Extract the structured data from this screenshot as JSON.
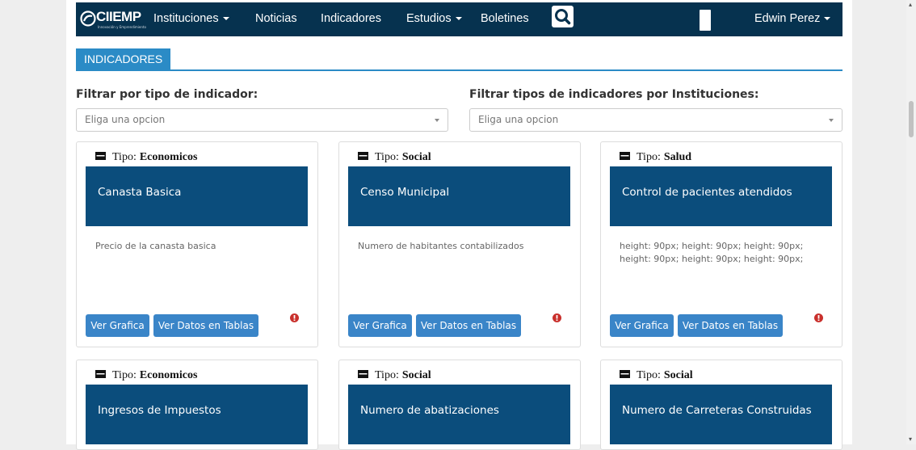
{
  "navbar": {
    "brand": "CIIEMP",
    "brand_sub": "Innovación y Emprendimiento",
    "items": [
      {
        "label": "Instituciones",
        "caret": true
      },
      {
        "label": "Noticias",
        "caret": false
      },
      {
        "label": "Indicadores",
        "caret": false
      },
      {
        "label": "Estudios",
        "caret": true
      },
      {
        "label": "Boletines",
        "caret": false
      }
    ],
    "user": "Edwin Perez",
    "icons": [
      "search-icon",
      "caret-down-icon"
    ]
  },
  "section": {
    "title": "INDICADORES"
  },
  "filters": {
    "type_label": "Filtrar por tipo de indicador:",
    "type_placeholder": "Eliga una opcion",
    "inst_label": "Filtrar tipos de indicadores por Instituciones:",
    "inst_placeholder": "Eliga una opcion"
  },
  "cards": [
    {
      "tipo_label": "Tipo:",
      "tipo": "Economicos",
      "title": "Canasta Basica",
      "desc": "Precio de la canasta basica",
      "btn_grafica": "Ver Grafica",
      "btn_tablas": "Ver Datos en Tablas"
    },
    {
      "tipo_label": "Tipo:",
      "tipo": "Social",
      "title": "Censo Municipal",
      "desc": "Numero de habitantes contabilizados",
      "btn_grafica": "Ver Grafica",
      "btn_tablas": "Ver Datos en Tablas"
    },
    {
      "tipo_label": "Tipo:",
      "tipo": "Salud",
      "title": "Control de pacientes atendidos",
      "desc": "height: 90px; height: 90px; height: 90px; height: 90px; height: 90px; height: 90px;",
      "btn_grafica": "Ver Grafica",
      "btn_tablas": "Ver Datos en Tablas"
    },
    {
      "tipo_label": "Tipo:",
      "tipo": "Economicos",
      "title": "Ingresos de Impuestos"
    },
    {
      "tipo_label": "Tipo:",
      "tipo": "Social",
      "title": "Numero de abatizaciones"
    },
    {
      "tipo_label": "Tipo:",
      "tipo": "Social",
      "title": "Numero de Carreteras Construidas"
    }
  ],
  "colors": {
    "navbar": "#06324f",
    "accent": "#2b8bc6",
    "banner": "#0b4d7c",
    "button": "#3a85c8",
    "alert": "#c9302c"
  }
}
